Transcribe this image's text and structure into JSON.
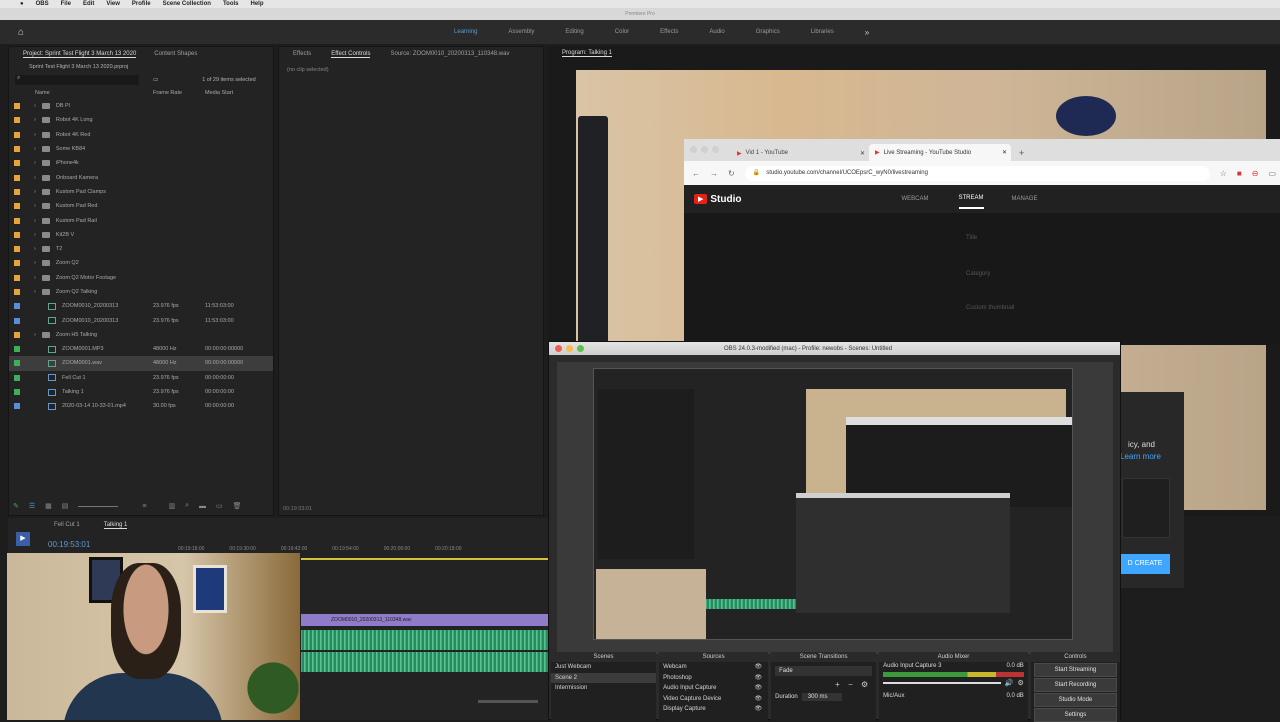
{
  "menubar": {
    "apple": "",
    "items": [
      "OBS",
      "File",
      "Edit",
      "View",
      "Profile",
      "Scene Collection",
      "Tools",
      "Help"
    ]
  },
  "premiere": {
    "title": "Premiere Pro",
    "workspaces": [
      "Learning",
      "Assembly",
      "Editing",
      "Color",
      "Effects",
      "Audio",
      "Graphics",
      "Libraries"
    ],
    "project": {
      "tabs": [
        "Project: Sprint Test Flight 3 March 13 2020",
        "Content Shapes"
      ],
      "file": "Sprint Test Flight 3 March 13 2020.prproj",
      "count": "1 of 29 items selected",
      "col_name": "Name",
      "col_rate": "Frame Rate",
      "col_start": "Media Start",
      "rows": [
        {
          "name": "DB Pl",
          "color": "#e8a33c",
          "type": "folder"
        },
        {
          "name": "Robot 4K Long",
          "color": "#e8a33c",
          "type": "folder"
        },
        {
          "name": "Robot 4K Red",
          "color": "#e8a33c",
          "type": "folder"
        },
        {
          "name": "Some KB84",
          "color": "#e8a33c",
          "type": "folder"
        },
        {
          "name": "iPhone4k",
          "color": "#e8a33c",
          "type": "folder"
        },
        {
          "name": "Onboard Kamera",
          "color": "#e8a33c",
          "type": "folder"
        },
        {
          "name": "Kustom Pad Clamps",
          "color": "#e8a33c",
          "type": "folder"
        },
        {
          "name": "Kustom Pad Red",
          "color": "#e8a33c",
          "type": "folder"
        },
        {
          "name": "Kustom Pad Rail",
          "color": "#e8a33c",
          "type": "folder"
        },
        {
          "name": "Kit2B V",
          "color": "#e8a33c",
          "type": "folder"
        },
        {
          "name": "T2",
          "color": "#e8a33c",
          "type": "folder"
        },
        {
          "name": "Zoom Q2",
          "color": "#e8a33c",
          "type": "folder"
        },
        {
          "name": "Zoom Q2 Motor Footage",
          "color": "#e8a33c",
          "type": "folder"
        },
        {
          "name": "Zoom Q2 Talking",
          "color": "#e8a33c",
          "type": "folder"
        },
        {
          "name": "ZOOM0010_20200313",
          "color": "#5b8ed8",
          "type": "clip",
          "rate": "23.976 fps",
          "start": "11:53:03:00"
        },
        {
          "name": "ZOOM0010_20200313",
          "color": "#5b8ed8",
          "type": "clip",
          "rate": "23.976 fps",
          "start": "11:53:03:00"
        },
        {
          "name": "Zoom H5 Talking",
          "color": "#e8a33c",
          "type": "folder"
        },
        {
          "name": "ZOOM0001.MP3",
          "color": "#3fae5a",
          "type": "clip",
          "rate": "48000 Hz",
          "start": "00:00:00:00000"
        },
        {
          "name": "ZOOM0001.wav",
          "color": "#3fae5a",
          "type": "clip",
          "rate": "48000 Hz",
          "start": "00:00:00:00000"
        },
        {
          "name": "Fell Cut 1",
          "color": "#3fae5a",
          "type": "seq",
          "rate": "23.976 fps",
          "start": "00:00:00:00"
        },
        {
          "name": "Talking 1",
          "color": "#3fae5a",
          "type": "seq",
          "rate": "23.976 fps",
          "start": "00:00:00:00"
        },
        {
          "name": "2020-03-14 10-33-01.mp4",
          "color": "#5b8ed8",
          "type": "seq",
          "rate": "30.00 fps",
          "start": "00:00:00:00"
        }
      ]
    },
    "effects": {
      "tabs": [
        "Effects",
        "Effect Controls",
        "Source: ZOOM0010_20200313_110348.wav"
      ],
      "empty": "(no clip selected)",
      "timecode": "00:19:33:01"
    },
    "program": {
      "title": "Program: Talking 1"
    },
    "timeline": {
      "tabs": [
        "Fell Cut 1",
        "Talking 1"
      ],
      "timecode": "00:19:53:01",
      "ruler": [
        "00:19:18:00",
        "00:19:30:00",
        "00:19:42:00",
        "00:19:54:00",
        "00:20:06:00",
        "00:20:18:00"
      ],
      "clip_label": "ZOOM0010_20200313_110348.wav"
    }
  },
  "browser": {
    "tabs": [
      "Vid 1 - YouTube",
      "Live Streaming - YouTube Studio"
    ],
    "url": "studio.youtube.com/channel/UCOEpsrC_wyN0/livestreaming",
    "brand": "Studio",
    "nav": [
      "WEBCAM",
      "STREAM",
      "MANAGE"
    ],
    "fields": [
      "Title",
      "Category",
      "Custom thumbnail"
    ],
    "side_text": "icy, and",
    "side_link": "Learn more",
    "create_button": "D CREATE"
  },
  "obs": {
    "title": "OBS 24.0.3-modified (mac) - Profile: newobs - Scenes: Untitled",
    "panels": {
      "scenes": {
        "title": "Scenes",
        "items": [
          "Just Webcam",
          "Scene 2",
          "Intermission"
        ],
        "selected": 1
      },
      "sources": {
        "title": "Sources",
        "items": [
          "Webcam",
          "Photoshop",
          "Audio Input Capture",
          "Video Capture Device",
          "Display Capture"
        ]
      },
      "transitions": {
        "title": "Scene Transitions",
        "value": "Fade",
        "duration_label": "Duration",
        "duration": "300 ms"
      },
      "mixer": {
        "title": "Audio Mixer",
        "channel": "Audio Input Capture 3",
        "db": "0.0 dB",
        "channel2": "Mic/Aux",
        "db2": "0.0 dB"
      },
      "controls": {
        "title": "Controls",
        "buttons": [
          "Start Streaming",
          "Start Recording",
          "Studio Mode",
          "Settings"
        ]
      }
    }
  }
}
